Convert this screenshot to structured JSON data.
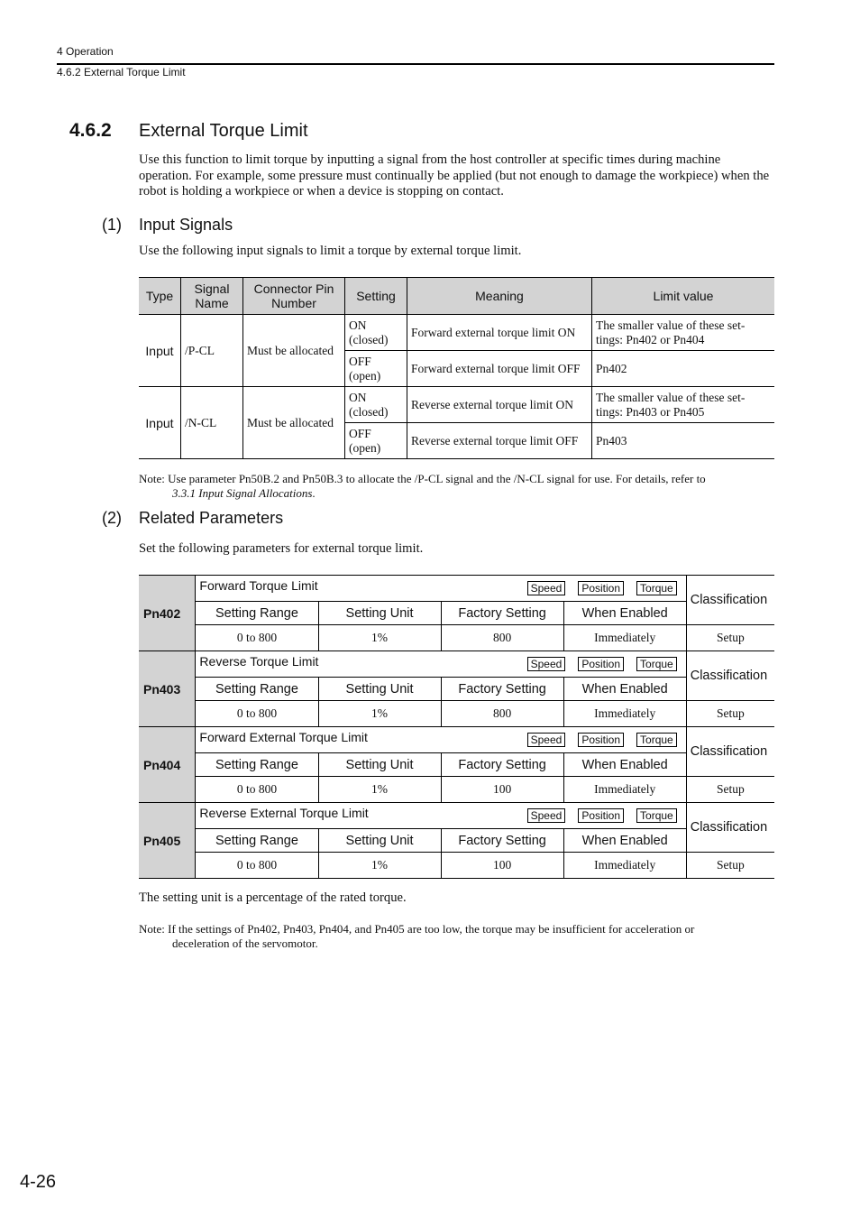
{
  "header": {
    "chapter": "4  Operation",
    "section": "4.6.2  External Torque Limit"
  },
  "section": {
    "number": "4.6.2",
    "title": "External Torque Limit",
    "intro": "Use this function to limit torque by inputting a signal from the host controller at specific times during machine operation. For example, some pressure must continually be applied (but not enough to damage the workpiece) when the robot is holding a workpiece or when a device is stopping on contact."
  },
  "input_signals": {
    "number": "(1)",
    "title": "Input Signals",
    "text": "Use the following input signals to limit a torque by external torque limit.",
    "columns": [
      "Type",
      "Signal Name",
      "Connector Pin Number",
      "Setting",
      "Meaning",
      "Limit value"
    ],
    "rows": [
      {
        "type": "Input",
        "signal": "/P-CL",
        "pin": "Must be allocated",
        "settings": [
          {
            "setting": "ON (closed)",
            "meaning": "Forward external torque limit ON",
            "limit": "The smaller value of these set-tings: Pn402 or Pn404"
          },
          {
            "setting": "OFF (open)",
            "meaning": "Forward external torque limit OFF",
            "limit": "Pn402"
          }
        ]
      },
      {
        "type": "Input",
        "signal": "/N-CL",
        "pin": "Must be allocated",
        "settings": [
          {
            "setting": "ON (closed)",
            "meaning": "Reverse external torque limit ON",
            "limit": "The smaller value of these set-tings: Pn403 or Pn405"
          },
          {
            "setting": "OFF (open)",
            "meaning": "Reverse external torque limit OFF",
            "limit": "Pn403"
          }
        ]
      }
    ],
    "note_label": "Note:",
    "note": "Use parameter Pn50B.2 and Pn50B.3 to allocate the /P-CL signal and the /N-CL signal for use. For details, refer to",
    "note_ref": "3.3.1 Input Signal Allocations",
    "note_end": "."
  },
  "related_parameters": {
    "number": "(2)",
    "title": "Related Parameters",
    "text": "Set the following parameters for external torque limit.",
    "headers": [
      "Setting Range",
      "Setting Unit",
      "Factory Setting",
      "When Enabled"
    ],
    "classification_label": "Classification",
    "badges": [
      "Speed",
      "Position",
      "Torque"
    ],
    "params": [
      {
        "id": "Pn402",
        "name": "Forward Torque Limit",
        "range": "0 to 800",
        "unit": "1%",
        "factory": "800",
        "enabled": "Immediately",
        "classification": "Setup"
      },
      {
        "id": "Pn403",
        "name": "Reverse Torque Limit",
        "range": "0 to 800",
        "unit": "1%",
        "factory": "800",
        "enabled": "Immediately",
        "classification": "Setup"
      },
      {
        "id": "Pn404",
        "name": "Forward External Torque Limit",
        "range": "0 to 800",
        "unit": "1%",
        "factory": "100",
        "enabled": "Immediately",
        "classification": "Setup"
      },
      {
        "id": "Pn405",
        "name": "Reverse External Torque Limit",
        "range": "0 to 800",
        "unit": "1%",
        "factory": "100",
        "enabled": "Immediately",
        "classification": "Setup"
      }
    ],
    "after_text": "The setting unit is a percentage of the rated torque.",
    "note_label": "Note:",
    "note": "If the settings of Pn402, Pn403, Pn404, and Pn405 are too low, the torque may be insufficient for acceleration or",
    "note_cont": "deceleration of the servomotor."
  },
  "page_number": "4-26"
}
